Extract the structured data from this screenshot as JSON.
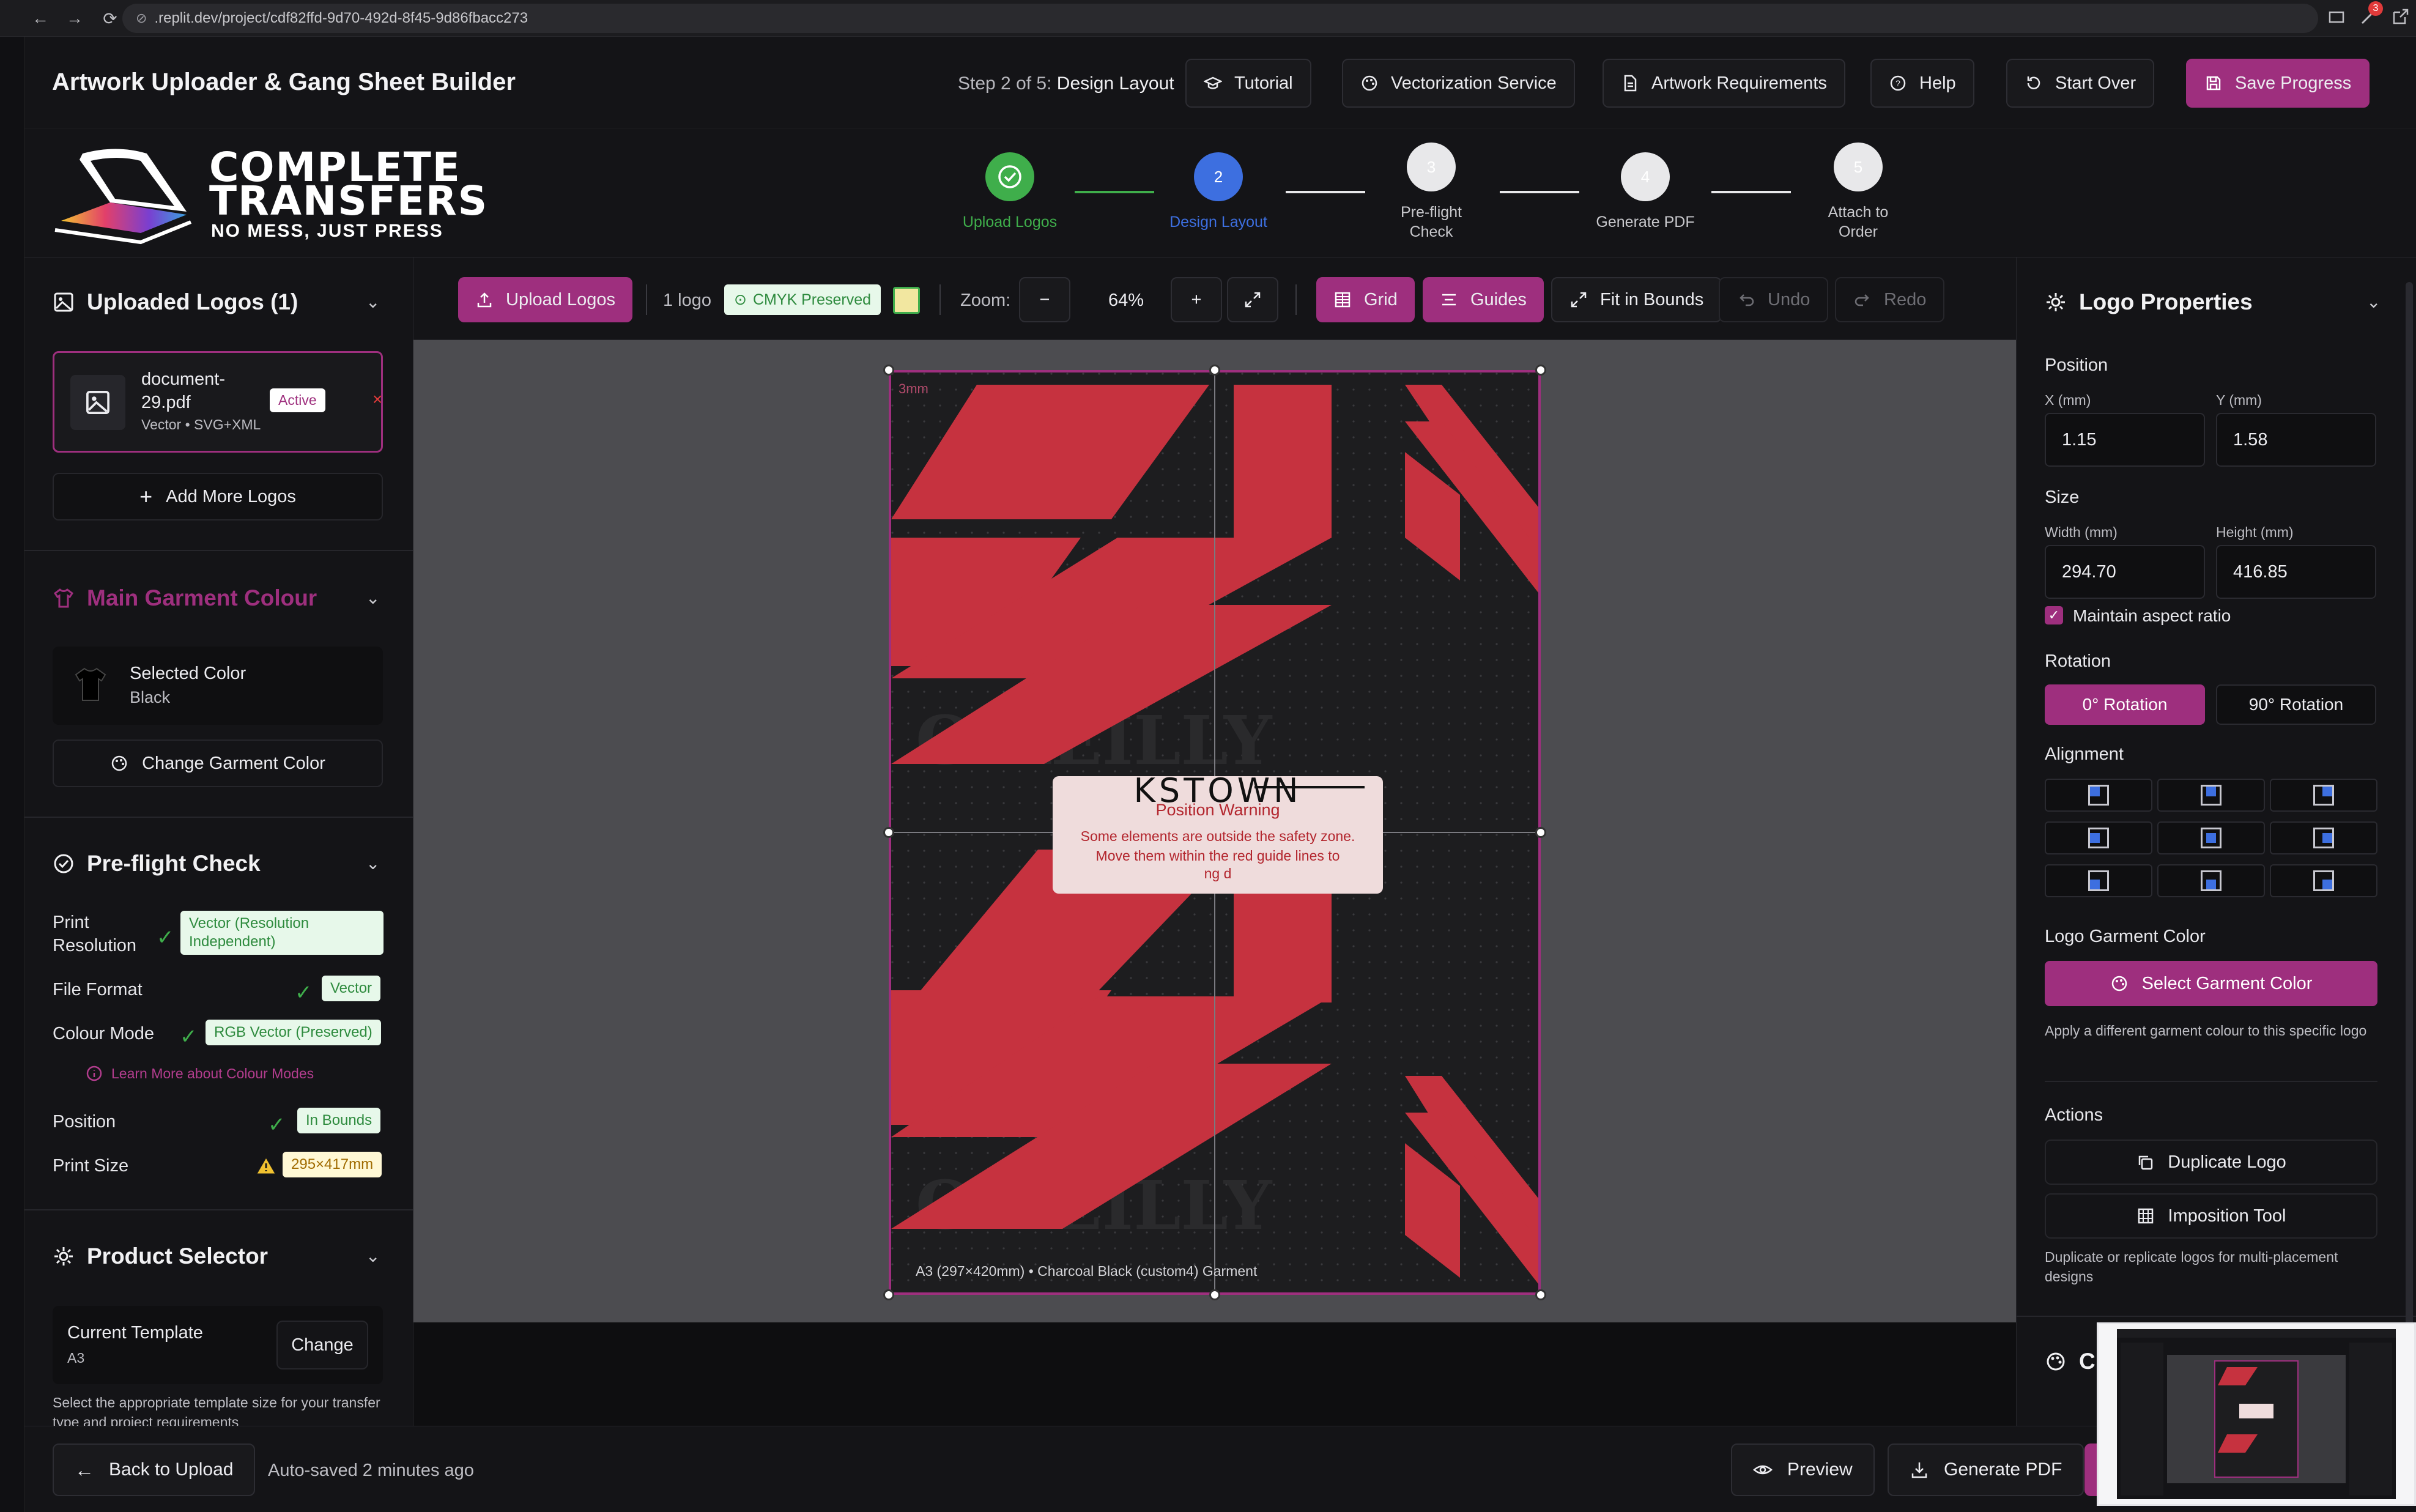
{
  "browser": {
    "url": ".replit.dev/project/cdf82ffd-9d70-492d-8f45-9d86fbacc273",
    "extension_badge": "3"
  },
  "header": {
    "title": "Artwork Uploader & Gang Sheet Builder",
    "step_prefix": "Step 2 of 5:",
    "step_current": "Design Layout",
    "buttons": {
      "tutorial": "Tutorial",
      "vectorization": "Vectorization Service",
      "artwork_requirements": "Artwork Requirements",
      "help": "Help",
      "start_over": "Start Over",
      "save_progress": "Save Progress"
    }
  },
  "brand": {
    "line1": "COMPLETE",
    "line2": "TRANSFERS",
    "tagline": "NO MESS, JUST PRESS"
  },
  "stepper": [
    {
      "num": "1",
      "label": "Upload Logos",
      "state": "done"
    },
    {
      "num": "2",
      "label": "Design Layout",
      "state": "current"
    },
    {
      "num": "3",
      "label": "Pre-flight Check",
      "state": "todo"
    },
    {
      "num": "4",
      "label": "Generate PDF",
      "state": "todo"
    },
    {
      "num": "5",
      "label": "Attach to Order",
      "state": "todo"
    }
  ],
  "left": {
    "uploaded": {
      "title": "Uploaded Logos (1)",
      "file_name": "document-29.pdf",
      "file_meta": "Vector • SVG+XML",
      "active": "Active",
      "add_more": "Add More Logos"
    },
    "garment": {
      "title": "Main Garment Colour",
      "selected_label": "Selected Color",
      "selected_value": "Black",
      "change_btn": "Change Garment Color"
    },
    "preflight": {
      "title": "Pre-flight Check",
      "rows": [
        {
          "label": "Print Resolution",
          "badge": "Vector (Resolution Independent)"
        },
        {
          "label": "File Format",
          "badge": "Vector"
        },
        {
          "label": "Colour Mode",
          "badge": "RGB Vector (Preserved)"
        },
        {
          "label": "Position",
          "badge": "In Bounds"
        },
        {
          "label": "Print Size",
          "badge": "295×417mm"
        }
      ],
      "learn_more": "Learn More about Colour Modes"
    },
    "product": {
      "title": "Product Selector",
      "current_label": "Current Template",
      "current_value": "A3",
      "change_btn": "Change",
      "helper": "Select the appropriate template size for your transfer type and project requirements"
    }
  },
  "toolbar": {
    "upload": "Upload Logos",
    "count": "1 logo",
    "cmyk": "CMYK Preserved",
    "zoom_label": "Zoom:",
    "zoom_value": "64%",
    "grid": "Grid",
    "guides": "Guides",
    "fit": "Fit in Bounds",
    "undo": "Undo",
    "redo": "Redo"
  },
  "canvas": {
    "safety_label": "3mm",
    "footer": "A3 (297×420mm) • Charcoal Black (custom4) Garment",
    "art_text_1": "O'REILLY",
    "art_text_2": "KSTOWN",
    "warning_title": "Position Warning",
    "warning_body": "Some elements are outside the safety zone. Move them within the red guide lines to",
    "warning_tail": "ng d"
  },
  "right": {
    "title": "Logo Properties",
    "position": "Position",
    "x_label": "X (mm)",
    "x_value": "1.15",
    "y_label": "Y (mm)",
    "y_value": "1.58",
    "size": "Size",
    "w_label": "Width (mm)",
    "w_value": "294.70",
    "h_label": "Height (mm)",
    "h_value": "416.85",
    "aspect": "Maintain aspect ratio",
    "rotation": "Rotation",
    "rot0": "0° Rotation",
    "rot90": "90° Rotation",
    "alignment": "Alignment",
    "garment_title": "Logo Garment Color",
    "garment_btn": "Select Garment Color",
    "garment_help": "Apply a different garment colour to this specific logo",
    "actions": "Actions",
    "duplicate": "Duplicate Logo",
    "imposition": "Imposition Tool",
    "actions_help": "Duplicate or replicate logos for multi-placement designs",
    "next_section": "C"
  },
  "bottom": {
    "back": "Back to Upload",
    "autosave": "Auto-saved 2 minutes ago",
    "preview": "Preview",
    "generate": "Generate PDF"
  },
  "colors": {
    "accent": "#9e2f7e",
    "artwork_red": "#c6323f",
    "success": "#3fae4b",
    "current_step": "#3d6fe0"
  }
}
